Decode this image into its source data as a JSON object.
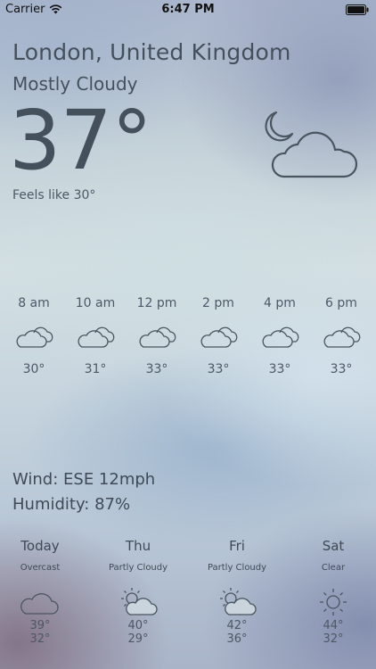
{
  "status_bar": {
    "carrier": "Carrier",
    "time": "6:47 PM",
    "icons": [
      "wifi-icon",
      "battery-icon"
    ]
  },
  "location": "London, United Kingdom",
  "condition": "Mostly Cloudy",
  "temperature": "37",
  "degree_symbol": "°",
  "feels_like": "Feels like 30°",
  "main_icon": "moon-cloud-icon",
  "hourly": [
    {
      "time": "8 am",
      "temp": "30°",
      "icon": "cloudy-icon"
    },
    {
      "time": "10 am",
      "temp": "31°",
      "icon": "cloudy-icon"
    },
    {
      "time": "12 pm",
      "temp": "33°",
      "icon": "cloudy-icon"
    },
    {
      "time": "2 pm",
      "temp": "33°",
      "icon": "cloudy-icon"
    },
    {
      "time": "4 pm",
      "temp": "33°",
      "icon": "cloudy-icon"
    },
    {
      "time": "6 pm",
      "temp": "33°",
      "icon": "cloudy-icon"
    }
  ],
  "wind": "Wind: ESE 12mph",
  "humidity": "Humidity: 87%",
  "daily": [
    {
      "day": "Today",
      "condition": "Overcast",
      "high": "39°",
      "low": "32°",
      "icon": "cloud-icon"
    },
    {
      "day": "Thu",
      "condition": "Partly Cloudy",
      "high": "40°",
      "low": "29°",
      "icon": "partly-cloudy-icon"
    },
    {
      "day": "Fri",
      "condition": "Partly Cloudy",
      "high": "42°",
      "low": "36°",
      "icon": "partly-cloudy-icon"
    },
    {
      "day": "Sat",
      "condition": "Clear",
      "high": "44°",
      "low": "32°",
      "icon": "sun-icon"
    }
  ],
  "colors": {
    "text": "#45505d",
    "icon_stroke": "#4a5560"
  }
}
